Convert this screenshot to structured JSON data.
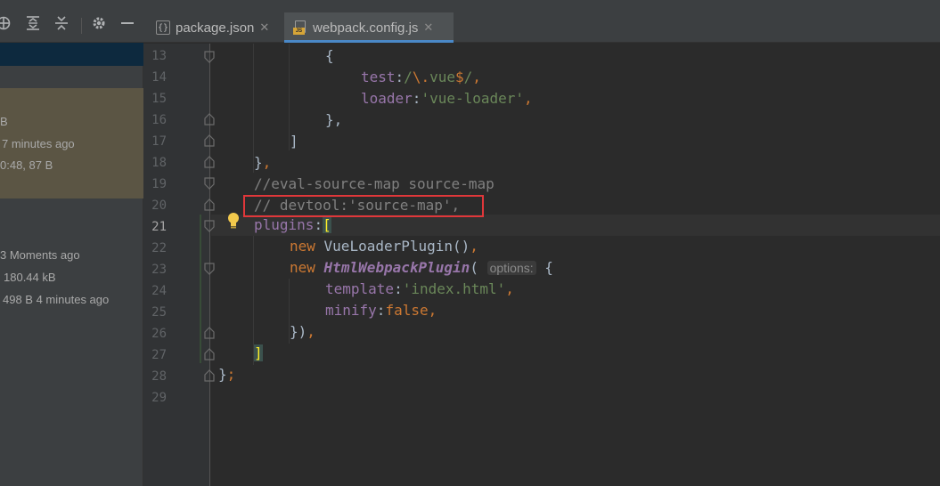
{
  "sidebar": {
    "toolbar_icons": [
      "crosshair-icon",
      "expand-all-icon",
      "collapse-all-icon",
      "gear-icon",
      "minimize-icon"
    ],
    "entries": [
      {
        "text": "B"
      },
      {
        "text": "7 minutes ago"
      },
      {
        "text": "0:48, 87 B"
      },
      {
        "text": "3 Moments ago"
      },
      {
        "text": "180.44 kB"
      },
      {
        "text": "498 B 4 minutes ago"
      }
    ]
  },
  "tabs": [
    {
      "label": "package.json",
      "icon": "json-file-icon",
      "active": false
    },
    {
      "label": "webpack.config.js",
      "icon": "js-file-icon",
      "active": true
    }
  ],
  "editor": {
    "line_numbers": [
      "13",
      "14",
      "15",
      "16",
      "17",
      "18",
      "19",
      "20",
      "21",
      "22",
      "23",
      "24",
      "25",
      "26",
      "27",
      "28",
      "29"
    ],
    "current_line": "21",
    "code": {
      "l13": "{",
      "l14_prop": "test",
      "l14_colon": ":",
      "l14_re_open": "/",
      "l14_re_esc": "\\.",
      "l14_re_body": "vue",
      "l14_re_end": "$",
      "l14_re_close": "/",
      "l14_comma": ",",
      "l15_prop": "loader",
      "l15_colon": ":",
      "l15_str": "'vue-loader'",
      "l15_comma": ",",
      "l16": "},",
      "l17": "]",
      "l18_brace": "}",
      "l18_comma": ",",
      "l19": "//eval-source-map source-map",
      "l20": "// devtool:'source-map',",
      "l21_prop": "plugins",
      "l21_colon": ":",
      "l21_bracket": "[",
      "l22_kw": "new",
      "l22_cls": " VueLoaderPlugin()",
      "l22_comma": ",",
      "l23_kw": "new",
      "l23_cls": "HtmlWebpackPlugin",
      "l23_paren": "(",
      "l23_hint": "options:",
      "l23_brace": "{",
      "l24_prop": "template",
      "l24_colon": ":",
      "l24_str": "'index.html'",
      "l24_comma": ",",
      "l25_prop": "minify",
      "l25_colon": ":",
      "l25_val": "false",
      "l25_comma": ",",
      "l26_close": "})",
      "l26_comma": ",",
      "l27": "]",
      "l28_brace": "}",
      "l28_semi": ";"
    }
  },
  "colors": {
    "keyword": "#cc7832",
    "property": "#9876aa",
    "string": "#6a8759",
    "comment": "#808080",
    "highlight_box": "#e0373a",
    "active_tab_underline": "#4a88c7"
  }
}
